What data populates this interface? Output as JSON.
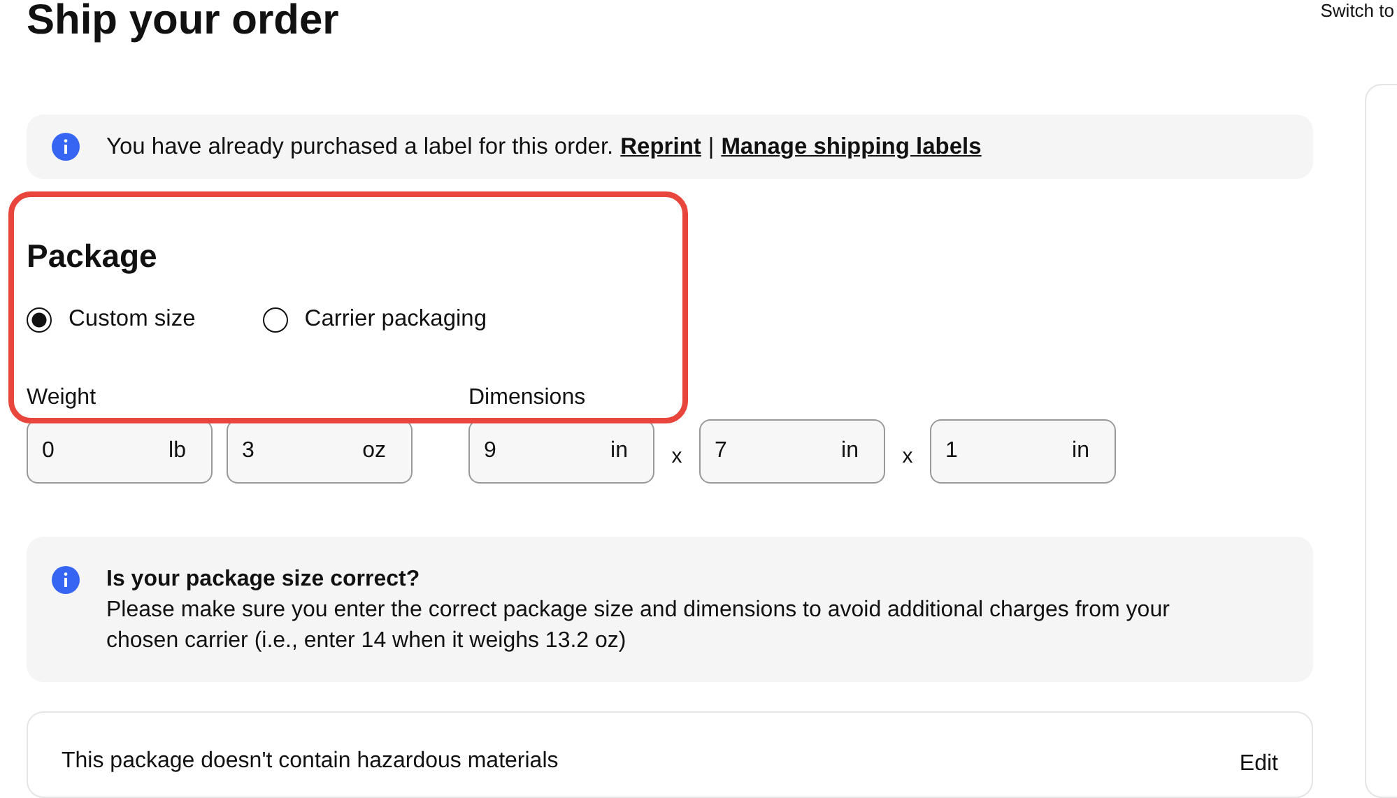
{
  "page": {
    "title": "Ship your order",
    "switch_link": "Switch to"
  },
  "purchased_notice": {
    "text": "You have already purchased a label for this order.",
    "links": [
      {
        "label": "Reprint"
      },
      {
        "label": "Manage shipping labels"
      }
    ],
    "separator": "|"
  },
  "package": {
    "title": "Package",
    "options": [
      {
        "label": "Custom size",
        "selected": true
      },
      {
        "label": "Carrier packaging",
        "selected": false
      }
    ]
  },
  "weight": {
    "label": "Weight",
    "fields": [
      {
        "value": "0",
        "unit": "lb"
      },
      {
        "value": "3",
        "unit": "oz"
      }
    ]
  },
  "dimensions": {
    "label": "Dimensions",
    "fields": [
      {
        "value": "9",
        "unit": "in"
      },
      {
        "separator": "x",
        "value": "7",
        "unit": "in"
      },
      {
        "separator": "x",
        "value": "1",
        "unit": "in"
      }
    ]
  },
  "size_notice": {
    "title": "Is your package size correct?",
    "text": "Please make sure you enter the correct package size and dimensions to avoid additional charges from your chosen carrier (i.e., enter 14 when it weighs 13.2 oz)"
  },
  "hazard": {
    "text": "This package doesn't contain hazardous materials",
    "action": "Edit"
  }
}
